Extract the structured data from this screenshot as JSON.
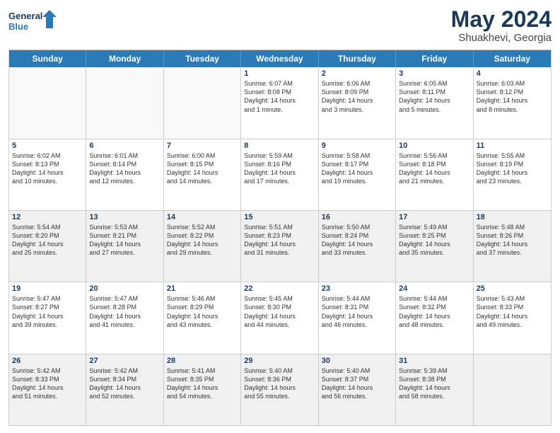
{
  "logo": {
    "line1": "General",
    "line2": "Blue"
  },
  "title": "May 2024",
  "subtitle": "Shuakhevi, Georgia",
  "days": [
    "Sunday",
    "Monday",
    "Tuesday",
    "Wednesday",
    "Thursday",
    "Friday",
    "Saturday"
  ],
  "rows": [
    [
      {
        "day": "",
        "lines": [],
        "empty": true
      },
      {
        "day": "",
        "lines": [],
        "empty": true
      },
      {
        "day": "",
        "lines": [],
        "empty": true
      },
      {
        "day": "1",
        "lines": [
          "Sunrise: 6:07 AM",
          "Sunset: 8:08 PM",
          "Daylight: 14 hours",
          "and 1 minute."
        ]
      },
      {
        "day": "2",
        "lines": [
          "Sunrise: 6:06 AM",
          "Sunset: 8:09 PM",
          "Daylight: 14 hours",
          "and 3 minutes."
        ]
      },
      {
        "day": "3",
        "lines": [
          "Sunrise: 6:05 AM",
          "Sunset: 8:11 PM",
          "Daylight: 14 hours",
          "and 5 minutes."
        ]
      },
      {
        "day": "4",
        "lines": [
          "Sunrise: 6:03 AM",
          "Sunset: 8:12 PM",
          "Daylight: 14 hours",
          "and 8 minutes."
        ]
      }
    ],
    [
      {
        "day": "5",
        "lines": [
          "Sunrise: 6:02 AM",
          "Sunset: 8:13 PM",
          "Daylight: 14 hours",
          "and 10 minutes."
        ]
      },
      {
        "day": "6",
        "lines": [
          "Sunrise: 6:01 AM",
          "Sunset: 8:14 PM",
          "Daylight: 14 hours",
          "and 12 minutes."
        ]
      },
      {
        "day": "7",
        "lines": [
          "Sunrise: 6:00 AM",
          "Sunset: 8:15 PM",
          "Daylight: 14 hours",
          "and 14 minutes."
        ]
      },
      {
        "day": "8",
        "lines": [
          "Sunrise: 5:59 AM",
          "Sunset: 8:16 PM",
          "Daylight: 14 hours",
          "and 17 minutes."
        ]
      },
      {
        "day": "9",
        "lines": [
          "Sunrise: 5:58 AM",
          "Sunset: 8:17 PM",
          "Daylight: 14 hours",
          "and 19 minutes."
        ]
      },
      {
        "day": "10",
        "lines": [
          "Sunrise: 5:56 AM",
          "Sunset: 8:18 PM",
          "Daylight: 14 hours",
          "and 21 minutes."
        ]
      },
      {
        "day": "11",
        "lines": [
          "Sunrise: 5:55 AM",
          "Sunset: 8:19 PM",
          "Daylight: 14 hours",
          "and 23 minutes."
        ]
      }
    ],
    [
      {
        "day": "12",
        "lines": [
          "Sunrise: 5:54 AM",
          "Sunset: 8:20 PM",
          "Daylight: 14 hours",
          "and 25 minutes."
        ],
        "shaded": true
      },
      {
        "day": "13",
        "lines": [
          "Sunrise: 5:53 AM",
          "Sunset: 8:21 PM",
          "Daylight: 14 hours",
          "and 27 minutes."
        ],
        "shaded": true
      },
      {
        "day": "14",
        "lines": [
          "Sunrise: 5:52 AM",
          "Sunset: 8:22 PM",
          "Daylight: 14 hours",
          "and 29 minutes."
        ],
        "shaded": true
      },
      {
        "day": "15",
        "lines": [
          "Sunrise: 5:51 AM",
          "Sunset: 8:23 PM",
          "Daylight: 14 hours",
          "and 31 minutes."
        ],
        "shaded": true
      },
      {
        "day": "16",
        "lines": [
          "Sunrise: 5:50 AM",
          "Sunset: 8:24 PM",
          "Daylight: 14 hours",
          "and 33 minutes."
        ],
        "shaded": true
      },
      {
        "day": "17",
        "lines": [
          "Sunrise: 5:49 AM",
          "Sunset: 8:25 PM",
          "Daylight: 14 hours",
          "and 35 minutes."
        ],
        "shaded": true
      },
      {
        "day": "18",
        "lines": [
          "Sunrise: 5:48 AM",
          "Sunset: 8:26 PM",
          "Daylight: 14 hours",
          "and 37 minutes."
        ],
        "shaded": true
      }
    ],
    [
      {
        "day": "19",
        "lines": [
          "Sunrise: 5:47 AM",
          "Sunset: 8:27 PM",
          "Daylight: 14 hours",
          "and 39 minutes."
        ]
      },
      {
        "day": "20",
        "lines": [
          "Sunrise: 5:47 AM",
          "Sunset: 8:28 PM",
          "Daylight: 14 hours",
          "and 41 minutes."
        ]
      },
      {
        "day": "21",
        "lines": [
          "Sunrise: 5:46 AM",
          "Sunset: 8:29 PM",
          "Daylight: 14 hours",
          "and 43 minutes."
        ]
      },
      {
        "day": "22",
        "lines": [
          "Sunrise: 5:45 AM",
          "Sunset: 8:30 PM",
          "Daylight: 14 hours",
          "and 44 minutes."
        ]
      },
      {
        "day": "23",
        "lines": [
          "Sunrise: 5:44 AM",
          "Sunset: 8:31 PM",
          "Daylight: 14 hours",
          "and 46 minutes."
        ]
      },
      {
        "day": "24",
        "lines": [
          "Sunrise: 5:44 AM",
          "Sunset: 8:32 PM",
          "Daylight: 14 hours",
          "and 48 minutes."
        ]
      },
      {
        "day": "25",
        "lines": [
          "Sunrise: 5:43 AM",
          "Sunset: 8:33 PM",
          "Daylight: 14 hours",
          "and 49 minutes."
        ]
      }
    ],
    [
      {
        "day": "26",
        "lines": [
          "Sunrise: 5:42 AM",
          "Sunset: 8:33 PM",
          "Daylight: 14 hours",
          "and 51 minutes."
        ],
        "shaded": true
      },
      {
        "day": "27",
        "lines": [
          "Sunrise: 5:42 AM",
          "Sunset: 8:34 PM",
          "Daylight: 14 hours",
          "and 52 minutes."
        ],
        "shaded": true
      },
      {
        "day": "28",
        "lines": [
          "Sunrise: 5:41 AM",
          "Sunset: 8:35 PM",
          "Daylight: 14 hours",
          "and 54 minutes."
        ],
        "shaded": true
      },
      {
        "day": "29",
        "lines": [
          "Sunrise: 5:40 AM",
          "Sunset: 8:36 PM",
          "Daylight: 14 hours",
          "and 55 minutes."
        ],
        "shaded": true
      },
      {
        "day": "30",
        "lines": [
          "Sunrise: 5:40 AM",
          "Sunset: 8:37 PM",
          "Daylight: 14 hours",
          "and 56 minutes."
        ],
        "shaded": true
      },
      {
        "day": "31",
        "lines": [
          "Sunrise: 5:39 AM",
          "Sunset: 8:38 PM",
          "Daylight: 14 hours",
          "and 58 minutes."
        ],
        "shaded": true
      },
      {
        "day": "",
        "lines": [],
        "empty": true,
        "shaded": true
      }
    ]
  ]
}
